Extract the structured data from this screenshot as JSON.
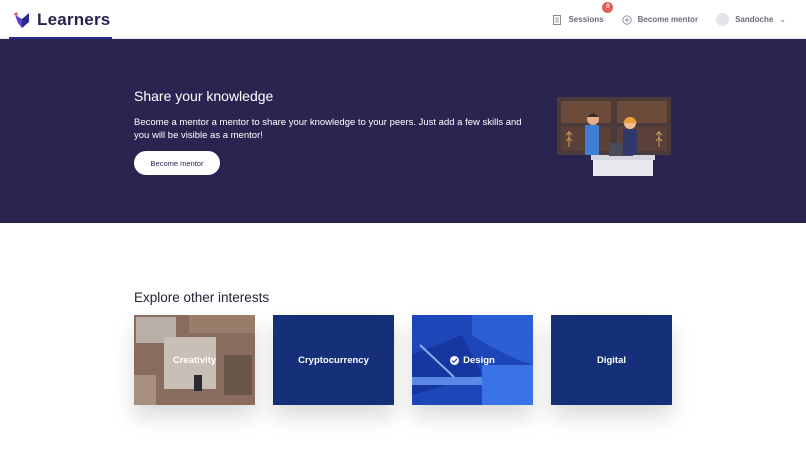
{
  "header": {
    "app_name": "Learners",
    "nav": {
      "sessions_label": "Sessions",
      "sessions_badge": "0",
      "become_mentor_label": "Become mentor",
      "user_name": "Sandoche"
    }
  },
  "hero": {
    "title": "Share your knowledge",
    "text": "Become a mentor a mentor to share your knowledge to your peers. Just add a few skills and you will be visible as a mentor!",
    "button_label": "Become mentor"
  },
  "explore": {
    "title": "Explore other interests",
    "cards": [
      {
        "label": "Creativity",
        "selected": false
      },
      {
        "label": "Cryptocurrency",
        "selected": false
      },
      {
        "label": "Design",
        "selected": true
      },
      {
        "label": "Digital",
        "selected": false
      }
    ]
  },
  "colors": {
    "brand": "#272450",
    "hero_bg": "#2a2550",
    "card_blue": "#153078",
    "badge": "#e25c5c"
  }
}
